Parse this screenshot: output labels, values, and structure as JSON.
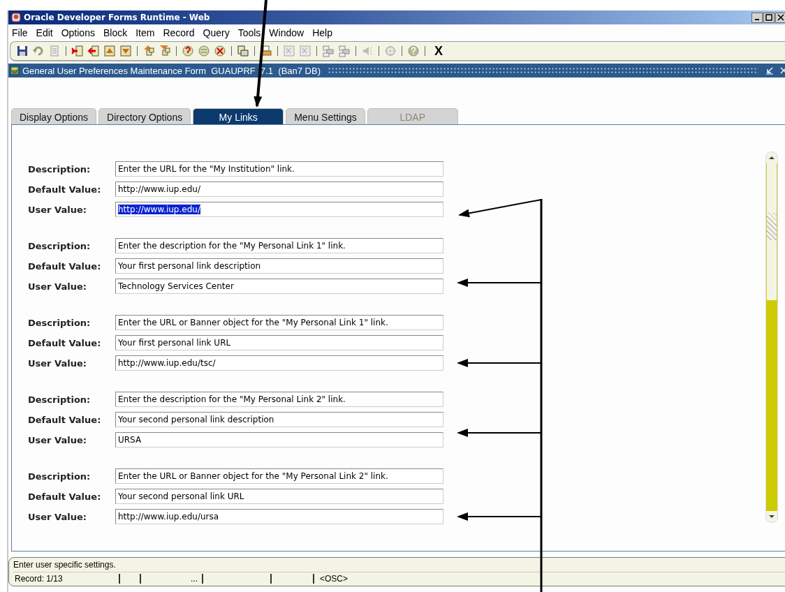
{
  "window": {
    "title": "Oracle Developer Forms Runtime - Web"
  },
  "menu": [
    "File",
    "Edit",
    "Options",
    "Block",
    "Item",
    "Record",
    "Query",
    "Tools",
    "Window",
    "Help"
  ],
  "toolbar": {
    "exit_label": "X"
  },
  "form": {
    "title": "General User Preferences Maintenance Form  GUAUPRF  7.1  (Ban7 DB)"
  },
  "tabs": [
    {
      "label": "Display Options",
      "selected": false,
      "disabled": false
    },
    {
      "label": "Directory Options",
      "selected": false,
      "disabled": false
    },
    {
      "label": "My Links",
      "selected": true,
      "disabled": false
    },
    {
      "label": "Menu Settings",
      "selected": false,
      "disabled": false
    },
    {
      "label": "LDAP",
      "selected": false,
      "disabled": true
    }
  ],
  "groups": [
    {
      "fields": [
        {
          "label": "Description:",
          "value": "Enter the URL for the \"My Institution\" link.",
          "focused": false
        },
        {
          "label": "Default Value:",
          "value": "http://www.iup.edu/",
          "focused": false
        },
        {
          "label": "User Value:",
          "value": "http://www.iup.edu/",
          "focused": true
        }
      ]
    },
    {
      "fields": [
        {
          "label": "Description:",
          "value": "Enter the description for the \"My Personal Link 1\" link.",
          "focused": false
        },
        {
          "label": "Default Value:",
          "value": "Your first personal link description",
          "focused": false
        },
        {
          "label": "User Value:",
          "value": "Technology Services Center",
          "focused": false
        }
      ]
    },
    {
      "fields": [
        {
          "label": "Description:",
          "value": "Enter the URL or Banner object for the \"My Personal Link 1\" link.",
          "focused": false
        },
        {
          "label": "Default Value:",
          "value": "Your first personal link URL",
          "focused": false
        },
        {
          "label": "User Value:",
          "value": "http://www.iup.edu/tsc/",
          "focused": false
        }
      ]
    },
    {
      "fields": [
        {
          "label": "Description:",
          "value": "Enter the description for the \"My Personal Link 2\" link.",
          "focused": false
        },
        {
          "label": "Default Value:",
          "value": "Your second personal link description",
          "focused": false
        },
        {
          "label": "User Value:",
          "value": "URSA",
          "focused": false
        }
      ]
    },
    {
      "fields": [
        {
          "label": "Description:",
          "value": "Enter the URL or Banner object for the \"My Personal Link 2\" link.",
          "focused": false
        },
        {
          "label": "Default Value:",
          "value": "Your second personal link URL",
          "focused": false
        },
        {
          "label": "User Value:",
          "value": "http://www.iup.edu/ursa",
          "focused": false
        }
      ]
    }
  ],
  "status_bar": {
    "message": "Enter user specific settings.",
    "record": "Record: 1/13",
    "cell_3": "...",
    "mode": "<OSC>"
  }
}
